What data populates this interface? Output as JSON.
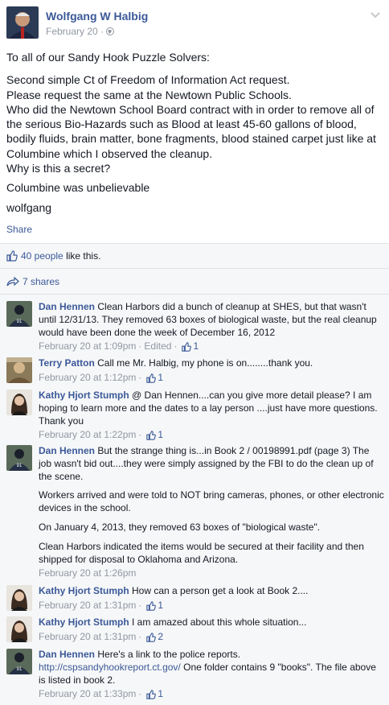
{
  "post": {
    "author": "Wolfgang W Halbig",
    "date": "February 20",
    "paragraphs": [
      "To all of our Sandy Hook Puzzle Solvers:",
      "Second simple Ct of Freedom of Information Act request.\nPlease request the same at the Newtown Public Schools.\nWho did the Newtown School Board contract with in order to remove all of the serious Bio-Hazards such as Blood at least 45-60 gallons of blood, bodily fluids, brain matter, bone fragments, blood stained carpet just like at Columbine which I observed the cleanup.\nWhy is this a secret?",
      "Columbine was unbelievable",
      "wolfgang"
    ],
    "share_label": "Share"
  },
  "ufi": {
    "likes_people": "40 people",
    "likes_suffix": "like this.",
    "shares": "7 shares"
  },
  "comments": [
    {
      "author": "Dan Hennen",
      "paragraphs": [
        "Clean Harbors did a bunch of cleanup at SHES, but that wasn't until 12/31/13. They removed 63 boxes of biological waste, but the real cleanup would have been done the week of December 16, 2012"
      ],
      "time": "February 20 at 1:09pm",
      "edited": "Edited",
      "likes": "1"
    },
    {
      "author": "Terry Patton",
      "paragraphs": [
        "Call me Mr. Halbig, my phone is on........thank you."
      ],
      "time": "February 20 at 1:12pm",
      "likes": "1"
    },
    {
      "author": "Kathy Hjort Stumph",
      "paragraphs": [
        "@ Dan Hennen....can you give more detail please? I am hoping to learn more and the dates to a lay person ....just have more questions. Thank you"
      ],
      "time": "February 20 at 1:22pm",
      "likes": "1"
    },
    {
      "author": "Dan Hennen",
      "paragraphs": [
        "But the strange thing is...in Book 2 / 00198991.pdf (page 3) The job wasn't bid out....they were simply assigned by the FBI to do the clean up of the scene.",
        "Workers arrived and were told to NOT bring cameras, phones, or other electronic devices in the school.",
        "On January 4, 2013, they removed 63 boxes of \"biological waste\".",
        "Clean Harbors indicated the items would be secured at their facility and then shipped for disposal to Oklahoma and Arizona."
      ],
      "time": "February 20 at 1:26pm"
    },
    {
      "author": "Kathy Hjort Stumph",
      "paragraphs": [
        "How can a person get a look at Book 2...."
      ],
      "time": "February 20 at 1:31pm",
      "likes": "1"
    },
    {
      "author": "Kathy Hjort Stumph",
      "paragraphs": [
        "I am amazed about this whole situation..."
      ],
      "time": "February 20 at 1:31pm",
      "likes": "2"
    },
    {
      "author": "Dan Hennen",
      "paragraphs": [
        "Here's a link to the police reports."
      ],
      "link_url": "http://cspsandyhookreport.ct.gov/",
      "link_after": "One folder contains 9 \"books\". The file above is listed in book 2.",
      "time": "February 20 at 1:33pm",
      "likes": "1"
    }
  ]
}
